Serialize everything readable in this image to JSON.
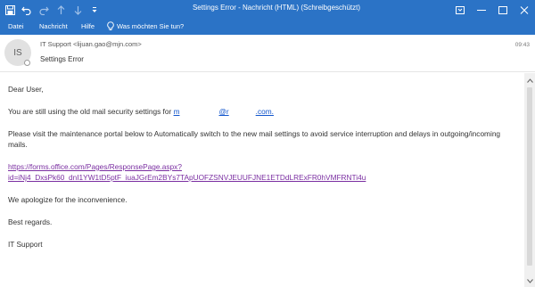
{
  "window": {
    "title": "Settings Error  -  Nachricht (HTML) (Schreibgeschützt)"
  },
  "ribbon": {
    "tabs": [
      "Datei",
      "Nachricht",
      "Hilfe"
    ],
    "tell_me": "Was möchten Sie tun?"
  },
  "header": {
    "avatar_initials": "IS",
    "sender": "IT Support <lijuan.gao@mjn.com>",
    "time": "09:43",
    "subject": "Settings Error"
  },
  "body": {
    "greeting": "Dear User,",
    "line1_prefix": "You are still using the old mail security settings for",
    "email_start": "m",
    "email_mid": "@r",
    "email_end": ".com.",
    "line2": "Please visit the maintenance portal below to Automatically switch to the new mail settings to avoid service interruption and delays in outgoing/incoming mails.",
    "link_line1": "https://forms.office.com/Pages/ResponsePage.aspx?",
    "link_line2": "id=iNj4_DxsPk60_dnI1YW1tD5ptF_iuaJGrEm2BYs7TApUOFZSNVJEUUFJNE1ETDdLRExFR0hVMFRNTi4u",
    "apology": "We apologize for the inconvenience.",
    "regards": "Best regards.",
    "signature": "IT Support"
  },
  "colors": {
    "titlebar": "#2b73c6",
    "link": "#7a2ea1",
    "email_link": "#1155cc"
  }
}
